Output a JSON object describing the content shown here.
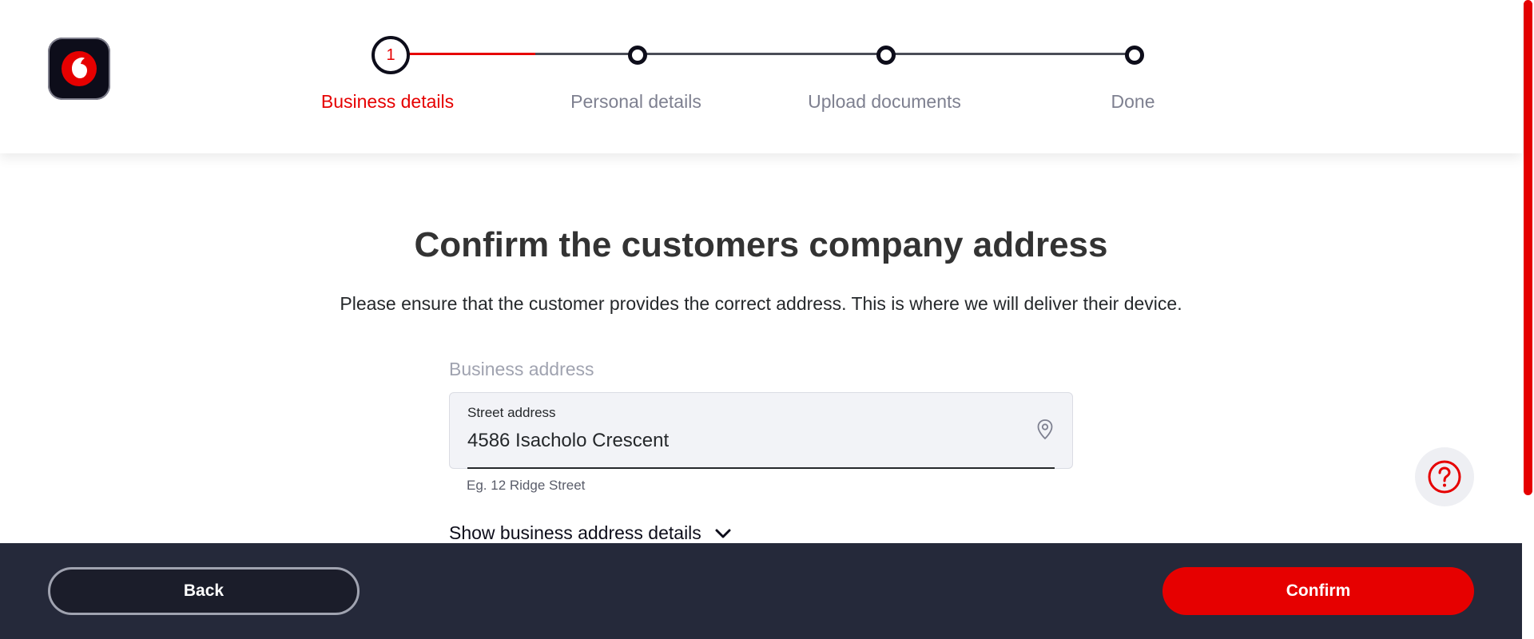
{
  "header": {
    "logo_icon": "vodafone-logo-icon",
    "stepper": {
      "current_step_number": "1",
      "steps": [
        {
          "label": "Business details",
          "state": "active"
        },
        {
          "label": "Personal details",
          "state": "upcoming"
        },
        {
          "label": "Upload documents",
          "state": "upcoming"
        },
        {
          "label": "Done",
          "state": "upcoming"
        }
      ],
      "progress_to_next_step": 0.5
    }
  },
  "main": {
    "title": "Confirm the customers company address",
    "subtitle": "Please ensure that the customer provides the correct address. This is where we will deliver their device.",
    "section_label": "Business address",
    "street_field": {
      "label": "Street address",
      "value": "4586 Isacholo Crescent",
      "icon": "location-pin-icon",
      "hint": "Eg. 12 Ridge Street"
    },
    "details_toggle": {
      "label": "Show business address details",
      "icon": "chevron-down-icon"
    },
    "help_icon": "help-question-icon"
  },
  "footer": {
    "back_label": "Back",
    "confirm_label": "Confirm"
  },
  "colors": {
    "accent": "#e60000",
    "dark": "#0d0d1a",
    "footer_bg": "#25293a",
    "muted_text": "#7e8090",
    "field_bg": "#f2f3f7"
  }
}
